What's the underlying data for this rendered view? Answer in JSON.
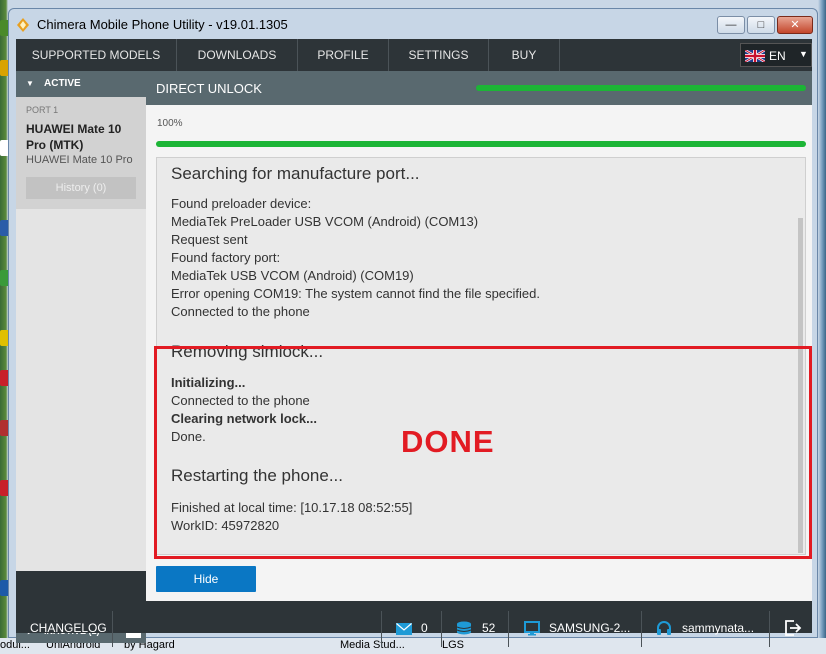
{
  "window": {
    "title": "Chimera Mobile Phone Utility - v19.01.1305",
    "minimize_glyph": "—",
    "maximize_glyph": "□",
    "close_glyph": "✕"
  },
  "menu": {
    "items": [
      "SUPPORTED MODELS",
      "DOWNLOADS",
      "PROFILE",
      "SETTINGS",
      "BUY"
    ],
    "language": {
      "code": "EN",
      "flag_icon": "uk-flag-icon",
      "caret": "▼"
    }
  },
  "sidebar": {
    "active_label": "ACTIVE",
    "port": {
      "label": "PORT 1",
      "model": "HUAWEI Mate 10 Pro (MTK)",
      "submodel": "HUAWEI Mate 10 Pro",
      "history_button": "History (0)"
    },
    "inactive_label": "INACTIVE (1)",
    "inactive_close": "✕"
  },
  "main": {
    "operation_title": "DIRECT UNLOCK",
    "progress_text": "100%",
    "progress_fraction": 1.0,
    "log": {
      "section1_title": "Searching for manufacture port...",
      "section1_lines": [
        "Found preloader device:",
        "MediaTek PreLoader USB VCOM (Android) (COM13)",
        "Request sent",
        "Found factory port:",
        "MediaTek USB VCOM (Android) (COM19)",
        "Error opening COM19: The system cannot find the file specified.",
        "Connected to the phone"
      ],
      "section2_title": "Removing simlock...",
      "section2_lines": [
        {
          "text": "Initializing...",
          "bold": true
        },
        {
          "text": "Connected to the phone",
          "bold": false
        },
        {
          "text": "Clearing network lock...",
          "bold": true
        },
        {
          "text": "Done.",
          "bold": false
        }
      ],
      "section3_title": "Restarting the phone...",
      "section3_lines": [
        "Finished at local time: [10.17.18 08:52:55]",
        "WorkID: 45972820"
      ]
    },
    "overlay_text": "DONE",
    "hide_button": "Hide"
  },
  "statusbar": {
    "changelog": "CHANGELOG",
    "messages_count": "0",
    "credits_count": "52",
    "device": "SAMSUNG-2...",
    "user": "sammynata...",
    "icons": [
      "mail-icon",
      "coins-icon",
      "monitor-icon",
      "headset-icon",
      "logout-icon"
    ]
  },
  "taskbar": [
    "odul...",
    "UniAndroid",
    "by Hagard",
    "Media Stud...",
    "LGS"
  ],
  "colors": {
    "accent_green": "#1cb536",
    "dark_header": "#2d3438",
    "slate_bar": "#59696f",
    "blue_button": "#0a77c4",
    "annotation_red": "#e21b23"
  }
}
